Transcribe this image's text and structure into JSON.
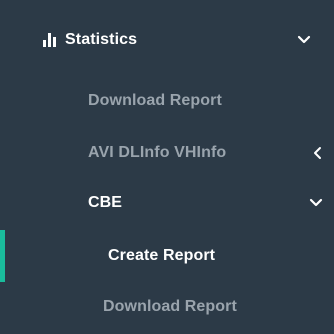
{
  "colors": {
    "background": "#2c3a47",
    "primary_text": "#ffffff",
    "muted_text": "#9aa4ad",
    "accent": "#1abc9c"
  },
  "sidebar": {
    "statistics": {
      "icon": "bar-chart-icon",
      "label": "Statistics",
      "chevron": "chevron-down-icon"
    },
    "items": [
      {
        "label": "Download Report"
      },
      {
        "label": "AVI DLInfo VHInfo",
        "chevron": "chevron-left-icon"
      }
    ],
    "cbe": {
      "label": "CBE",
      "chevron": "chevron-down-icon",
      "items": [
        {
          "label": "Create Report",
          "active": true
        },
        {
          "label": "Download Report"
        }
      ]
    }
  }
}
